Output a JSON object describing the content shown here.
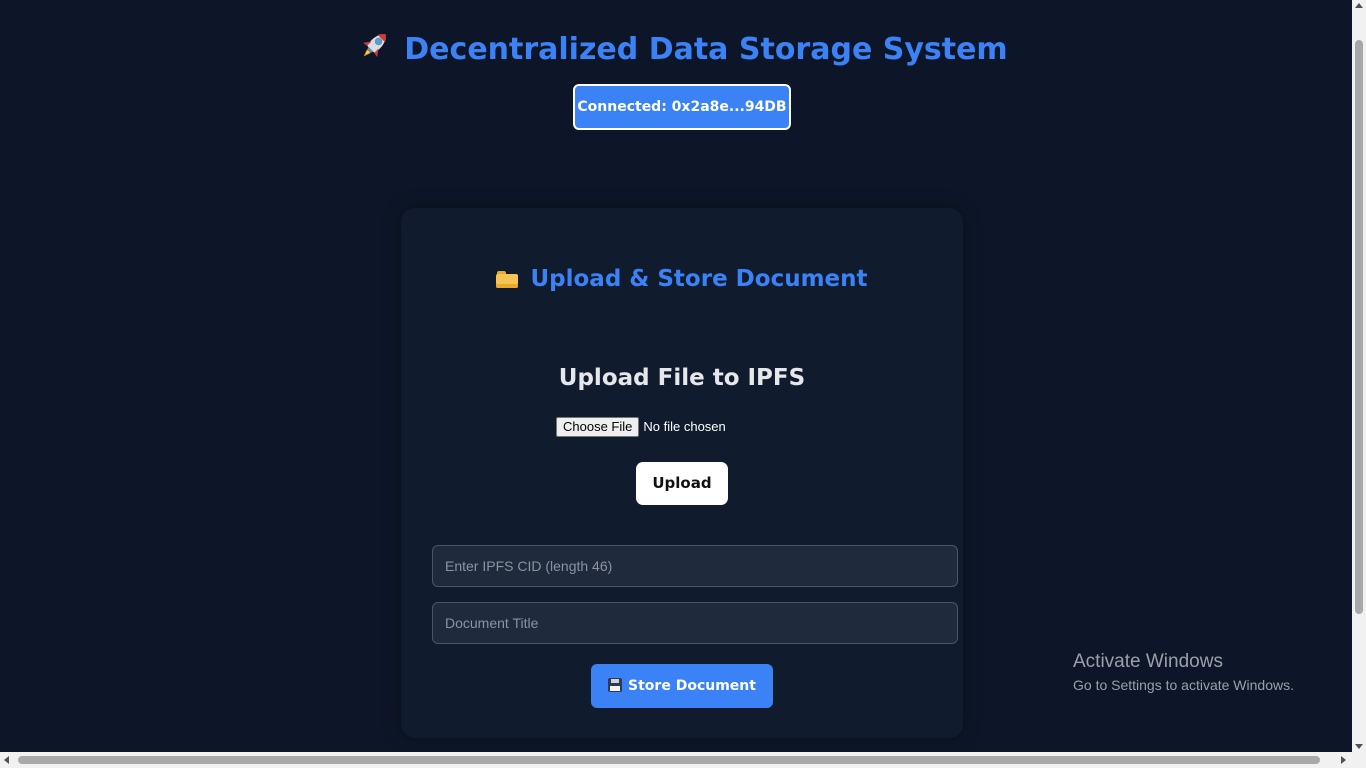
{
  "header": {
    "title": "Decentralized Data Storage System",
    "title_icon": "rocket-icon",
    "connect_label": "Connected: 0x2a8e...94DB"
  },
  "card": {
    "title": "Upload & Store Document",
    "title_icon": "folder-icon",
    "upload_heading": "Upload File to IPFS",
    "choose_file_label": "Choose File",
    "file_status": "No file chosen",
    "upload_label": "Upload",
    "cid_placeholder": "Enter IPFS CID (length 46)",
    "cid_value": "",
    "title_placeholder": "Document Title",
    "title_value": "",
    "store_label": "Store Document",
    "store_icon": "floppy-disk-icon"
  },
  "watermark": {
    "title": "Activate Windows",
    "subtitle": "Go to Settings to activate Windows."
  },
  "colors": {
    "background": "#0d1628",
    "card": "#111b2e",
    "accent": "#3b82f6",
    "heading": "#e5e7eb"
  }
}
